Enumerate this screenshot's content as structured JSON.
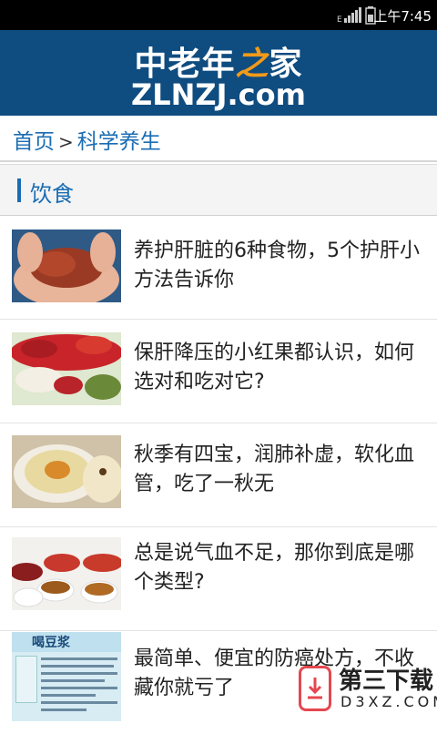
{
  "status_bar": {
    "network": "E",
    "time": "上午7:45"
  },
  "header": {
    "logo_cn_left": "中老年",
    "logo_cn_zhi": "之",
    "logo_cn_right": "家",
    "logo_en": "ZLNZJ.com"
  },
  "breadcrumb": {
    "home": "首页",
    "separator": ">",
    "current": "科学养生"
  },
  "section": {
    "title": "饮食"
  },
  "articles": [
    {
      "title": "养护肝脏的6种食物，5个护肝小方法告诉你",
      "thumb": "liver-in-hands"
    },
    {
      "title": "保肝降压的小红果都认识，如何选对和吃对它?",
      "thumb": "goji-berries"
    },
    {
      "title": "秋季有四宝，润肺补虚，软化血管，吃了一秋无",
      "thumb": "pear-soup"
    },
    {
      "title": "总是说气血不足，那你到底是哪个类型?",
      "thumb": "tea-cups-dates"
    },
    {
      "title": "最简单、便宜的防癌处方，不收藏你就亏了",
      "thumb": "soy-milk-poster",
      "thumb_heading": "喝豆浆"
    }
  ],
  "download_badge": {
    "name": "第三下载",
    "domain": "D3XZ.COM",
    "accent": "#e5474f"
  },
  "colors": {
    "header_bg": "#0f4c80",
    "link": "#1a6db3",
    "logo_accent": "#f29a1a"
  }
}
